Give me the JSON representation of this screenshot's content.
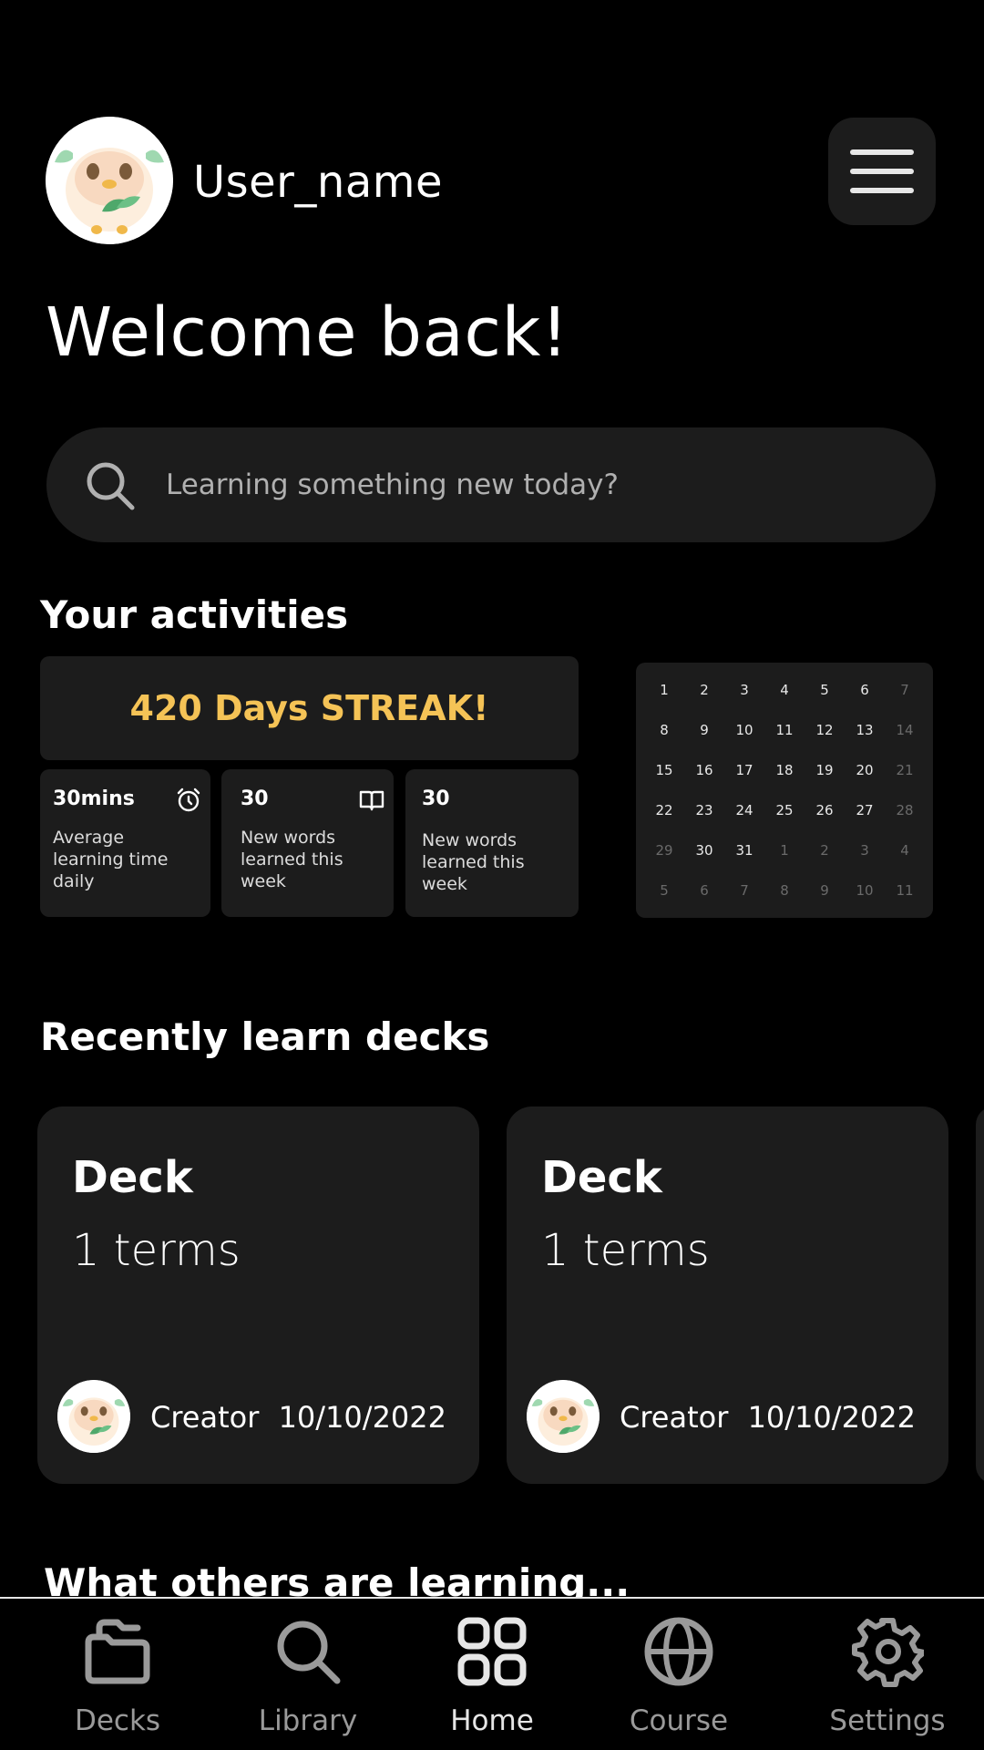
{
  "header": {
    "username": "User_name",
    "welcome": "Welcome back!"
  },
  "search": {
    "placeholder": "Learning something new today?"
  },
  "activities": {
    "title": "Your activities",
    "streak": "420 Days STREAK!",
    "stats": [
      {
        "value": "30mins",
        "description": "Average learning time daily",
        "icon": "alarm-clock-icon"
      },
      {
        "value": "30",
        "description": "New words learned this week",
        "icon": "book-icon"
      },
      {
        "value": "30",
        "description": "New words learned this week",
        "icon": ""
      }
    ],
    "calendar": {
      "rows": [
        [
          "1",
          "2",
          "3",
          "4",
          "5",
          "6",
          "7"
        ],
        [
          "8",
          "9",
          "10",
          "11",
          "12",
          "13",
          "14"
        ],
        [
          "15",
          "16",
          "17",
          "18",
          "19",
          "20",
          "21"
        ],
        [
          "22",
          "23",
          "24",
          "25",
          "26",
          "27",
          "28"
        ],
        [
          "29",
          "30",
          "31",
          "1",
          "2",
          "3",
          "4"
        ],
        [
          "5",
          "6",
          "7",
          "8",
          "9",
          "10",
          "11"
        ]
      ]
    }
  },
  "recent": {
    "title": "Recently learn decks",
    "decks": [
      {
        "title": "Deck",
        "terms": "1 terms",
        "creator": "Creator",
        "date": "10/10/2022"
      },
      {
        "title": "Deck",
        "terms": "1 terms",
        "creator": "Creator",
        "date": "10/10/2022"
      }
    ]
  },
  "others": {
    "title": "What others are learning..."
  },
  "nav": {
    "items": [
      {
        "label": "Decks",
        "icon": "folder-icon",
        "active": false
      },
      {
        "label": "Library",
        "icon": "search-icon",
        "active": false
      },
      {
        "label": "Home",
        "icon": "grid-icon",
        "active": true
      },
      {
        "label": "Course",
        "icon": "globe-icon",
        "active": false
      },
      {
        "label": "Settings",
        "icon": "gear-icon",
        "active": false
      }
    ]
  },
  "colors": {
    "background": "#000000",
    "card": "#1c1c1c",
    "streak": "#f5c356"
  }
}
